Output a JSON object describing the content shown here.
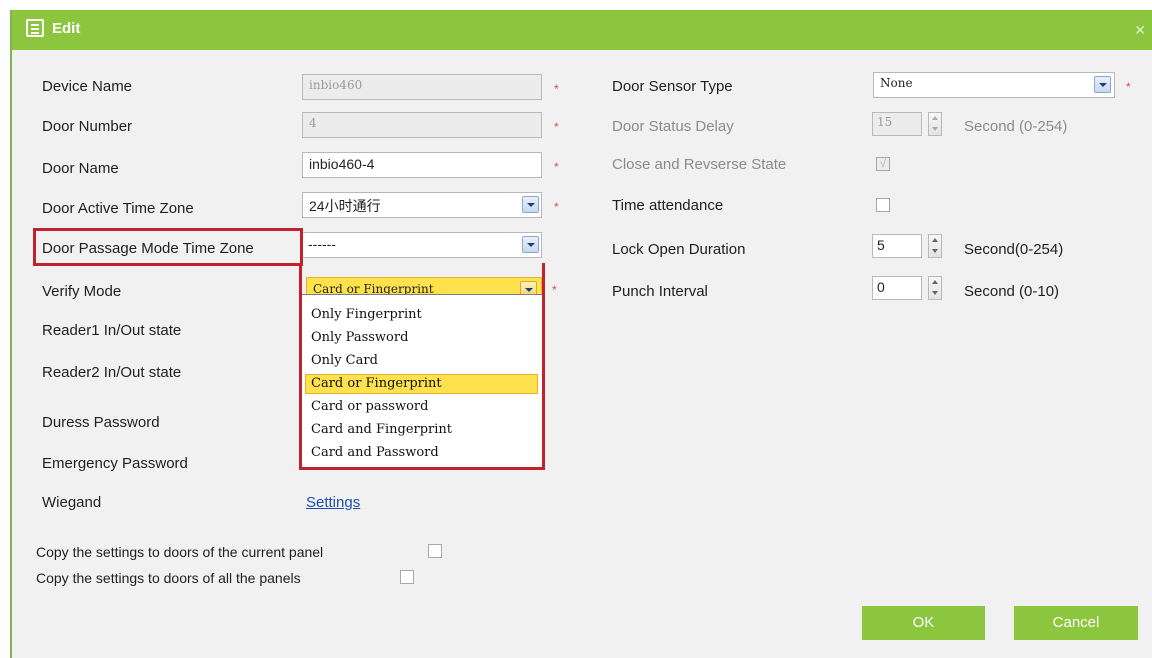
{
  "window": {
    "title": "Edit",
    "close_icon": "✕"
  },
  "left": {
    "device_name": {
      "label": "Device Name",
      "value": "inbio460"
    },
    "door_number": {
      "label": "Door Number",
      "value": "4"
    },
    "door_name": {
      "label": "Door Name",
      "value": "inbio460-4"
    },
    "active_tz": {
      "label": "Door Active Time Zone",
      "value": "24小时通行"
    },
    "passage_tz": {
      "label": "Door Passage Mode Time Zone",
      "value": "------"
    },
    "verify_mode": {
      "label": "Verify Mode",
      "value": "Card or Fingerprint",
      "options": [
        "Only Fingerprint",
        "Only Password",
        "Only Card",
        "Card or Fingerprint",
        "Card or password",
        "Card and Fingerprint",
        "Card and Password"
      ]
    },
    "reader1": {
      "label": "Reader1 In/Out state"
    },
    "reader2": {
      "label": "Reader2 In/Out state"
    },
    "duress": {
      "label": "Duress Password"
    },
    "emergency": {
      "label": "Emergency Password"
    },
    "wiegand": {
      "label": "Wiegand",
      "link": "Settings"
    }
  },
  "right": {
    "sensor_type": {
      "label": "Door Sensor Type",
      "value": "None"
    },
    "status_delay": {
      "label": "Door Status Delay",
      "value": "15",
      "unit": "Second (0-254)"
    },
    "close_reverse": {
      "label": "Close and Revserse State",
      "check": "√"
    },
    "time_attendance": {
      "label": "Time attendance"
    },
    "lock_open": {
      "label": "Lock Open Duration",
      "value": "5",
      "unit": "Second(0-254)"
    },
    "punch_interval": {
      "label": "Punch Interval",
      "value": "0",
      "unit": "Second (0-10)"
    }
  },
  "copy": {
    "current_panel": "Copy the settings to doors of the current panel",
    "all_panels": "Copy the settings to doors of all the panels"
  },
  "buttons": {
    "ok": "OK",
    "cancel": "Cancel"
  },
  "required_mark": "*",
  "colors": {
    "title_bar": "#8cc63f",
    "highlight": "#c0232c",
    "selected_option": "#fde24d"
  }
}
